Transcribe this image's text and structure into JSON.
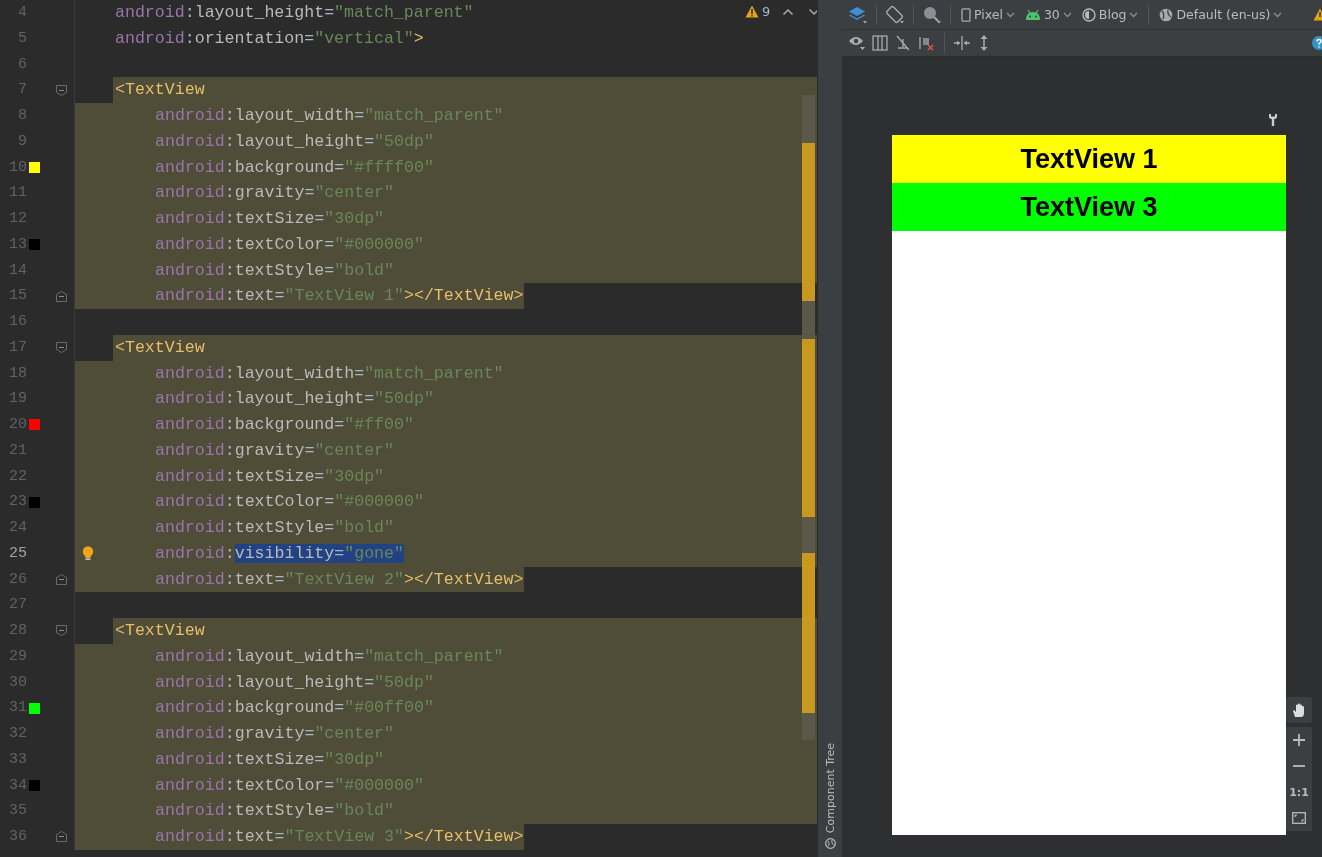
{
  "editor": {
    "warnings": "9",
    "lines": [
      {
        "num": "4",
        "current": false,
        "tokens": [
          {
            "ns": "android"
          },
          {
            "p": ":"
          },
          {
            "attr": "layout_height"
          },
          {
            "p": "="
          },
          {
            "str": "\"match_parent\""
          }
        ]
      },
      {
        "num": "5",
        "current": false,
        "tokens": [
          {
            "ns": "android"
          },
          {
            "p": ":"
          },
          {
            "attr": "orientation"
          },
          {
            "p": "="
          },
          {
            "str": "\"vertical\""
          },
          {
            "tag": ">"
          }
        ]
      },
      {
        "num": "6",
        "current": false
      },
      {
        "num": "7",
        "current": false,
        "tokens": [
          {
            "tag": "<TextView"
          }
        ],
        "children": [
          {
            "num": "8",
            "current": false,
            "tokens": [
              {
                "ns": "android"
              },
              {
                "p": ":"
              },
              {
                "attr": "layout_width"
              },
              {
                "p": "="
              },
              {
                "str": "\"match_parent\""
              }
            ]
          },
          {
            "num": "9",
            "current": false,
            "tokens": [
              {
                "ns": "android"
              },
              {
                "p": ":"
              },
              {
                "attr": "layout_height"
              },
              {
                "p": "="
              },
              {
                "str": "\"50dp\""
              }
            ]
          },
          {
            "num": "10",
            "current": false,
            "color": "#ffff00",
            "tokens": [
              {
                "ns": "android"
              },
              {
                "p": ":"
              },
              {
                "attr": "background"
              },
              {
                "p": "="
              },
              {
                "str": "\"#ffff00\""
              }
            ]
          },
          {
            "num": "11",
            "current": false,
            "tokens": [
              {
                "ns": "android"
              },
              {
                "p": ":"
              },
              {
                "attr": "gravity"
              },
              {
                "p": "="
              },
              {
                "str": "\"center\""
              }
            ]
          },
          {
            "num": "12",
            "current": false,
            "tokens": [
              {
                "ns": "android"
              },
              {
                "p": ":"
              },
              {
                "attr": "textSize"
              },
              {
                "p": "="
              },
              {
                "str": "\"30dp\""
              }
            ]
          },
          {
            "num": "13",
            "current": false,
            "color": "#000000",
            "tokens": [
              {
                "ns": "android"
              },
              {
                "p": ":"
              },
              {
                "attr": "textColor"
              },
              {
                "p": "="
              },
              {
                "str": "\"#000000\""
              }
            ]
          },
          {
            "num": "14",
            "current": false,
            "tokens": [
              {
                "ns": "android"
              },
              {
                "p": ":"
              },
              {
                "attr": "textStyle"
              },
              {
                "p": "="
              },
              {
                "str": "\"bold\""
              }
            ]
          },
          {
            "num": "15",
            "current": false,
            "tokens": [
              {
                "ns": "android"
              },
              {
                "p": ":"
              },
              {
                "attr": "text"
              },
              {
                "p": "="
              },
              {
                "str": "\"TextView 1\""
              },
              {
                "tag": "></TextView>"
              }
            ]
          }
        ]
      },
      {
        "num": "16",
        "current": false
      },
      {
        "num": "17",
        "current": false,
        "tokens": [
          {
            "tag": "<TextView"
          }
        ],
        "children": [
          {
            "num": "18",
            "current": false,
            "tokens": [
              {
                "ns": "android"
              },
              {
                "p": ":"
              },
              {
                "attr": "layout_width"
              },
              {
                "p": "="
              },
              {
                "str": "\"match_parent\""
              }
            ]
          },
          {
            "num": "19",
            "current": false,
            "tokens": [
              {
                "ns": "android"
              },
              {
                "p": ":"
              },
              {
                "attr": "layout_height"
              },
              {
                "p": "="
              },
              {
                "str": "\"50dp\""
              }
            ]
          },
          {
            "num": "20",
            "current": false,
            "color": "#ff0000",
            "tokens": [
              {
                "ns": "android"
              },
              {
                "p": ":"
              },
              {
                "attr": "background"
              },
              {
                "p": "="
              },
              {
                "str": "\"#ff00\""
              }
            ]
          },
          {
            "num": "21",
            "current": false,
            "tokens": [
              {
                "ns": "android"
              },
              {
                "p": ":"
              },
              {
                "attr": "gravity"
              },
              {
                "p": "="
              },
              {
                "str": "\"center\""
              }
            ]
          },
          {
            "num": "22",
            "current": false,
            "tokens": [
              {
                "ns": "android"
              },
              {
                "p": ":"
              },
              {
                "attr": "textSize"
              },
              {
                "p": "="
              },
              {
                "str": "\"30dp\""
              }
            ]
          },
          {
            "num": "23",
            "current": false,
            "color": "#000000",
            "tokens": [
              {
                "ns": "android"
              },
              {
                "p": ":"
              },
              {
                "attr": "textColor"
              },
              {
                "p": "="
              },
              {
                "str": "\"#000000\""
              }
            ]
          },
          {
            "num": "24",
            "current": false,
            "tokens": [
              {
                "ns": "android"
              },
              {
                "p": ":"
              },
              {
                "attr": "textStyle"
              },
              {
                "p": "="
              },
              {
                "str": "\"bold\""
              }
            ]
          },
          {
            "num": "25",
            "current": true,
            "hint": true,
            "tokens": [
              {
                "ns": "android"
              },
              {
                "p": ":"
              },
              {
                "selection": [
                  {
                    "attr": "visibility"
                  },
                  {
                    "p": "="
                  },
                  {
                    "str": "\"gone\""
                  }
                ]
              }
            ]
          },
          {
            "num": "26",
            "current": false,
            "tokens": [
              {
                "ns": "android"
              },
              {
                "p": ":"
              },
              {
                "attr": "text"
              },
              {
                "p": "="
              },
              {
                "str": "\"TextView 2\""
              },
              {
                "tag": "></TextView>"
              }
            ]
          }
        ]
      },
      {
        "num": "27",
        "current": false
      },
      {
        "num": "28",
        "current": false,
        "tokens": [
          {
            "tag": "<TextView"
          }
        ],
        "children": [
          {
            "num": "29",
            "current": false,
            "tokens": [
              {
                "ns": "android"
              },
              {
                "p": ":"
              },
              {
                "attr": "layout_width"
              },
              {
                "p": "="
              },
              {
                "str": "\"match_parent\""
              }
            ]
          },
          {
            "num": "30",
            "current": false,
            "tokens": [
              {
                "ns": "android"
              },
              {
                "p": ":"
              },
              {
                "attr": "layout_height"
              },
              {
                "p": "="
              },
              {
                "str": "\"50dp\""
              }
            ]
          },
          {
            "num": "31",
            "current": false,
            "color": "#00ff00",
            "tokens": [
              {
                "ns": "android"
              },
              {
                "p": ":"
              },
              {
                "attr": "background"
              },
              {
                "p": "="
              },
              {
                "str": "\"#00ff00\""
              }
            ]
          },
          {
            "num": "32",
            "current": false,
            "tokens": [
              {
                "ns": "android"
              },
              {
                "p": ":"
              },
              {
                "attr": "gravity"
              },
              {
                "p": "="
              },
              {
                "str": "\"center\""
              }
            ]
          },
          {
            "num": "33",
            "current": false,
            "tokens": [
              {
                "ns": "android"
              },
              {
                "p": ":"
              },
              {
                "attr": "textSize"
              },
              {
                "p": "="
              },
              {
                "str": "\"30dp\""
              }
            ]
          },
          {
            "num": "34",
            "current": false,
            "color": "#000000",
            "tokens": [
              {
                "ns": "android"
              },
              {
                "p": ":"
              },
              {
                "attr": "textColor"
              },
              {
                "p": "="
              },
              {
                "str": "\"#000000\""
              }
            ]
          },
          {
            "num": "35",
            "current": false,
            "tokens": [
              {
                "ns": "android"
              },
              {
                "p": ":"
              },
              {
                "attr": "textStyle"
              },
              {
                "p": "="
              },
              {
                "str": "\"bold\""
              }
            ]
          },
          {
            "num": "36",
            "current": false,
            "tokens": [
              {
                "ns": "android"
              },
              {
                "p": ":"
              },
              {
                "attr": "text"
              },
              {
                "p": "="
              },
              {
                "str": "\"TextView 3\""
              },
              {
                "tag": "></TextView>"
              }
            ]
          }
        ]
      }
    ]
  },
  "side_tab": {
    "label": "Component Tree"
  },
  "toolbar": {
    "device": "Pixel",
    "api": "30",
    "theme": "Blog",
    "locale": "Default (en-us)"
  },
  "preview": {
    "views": [
      {
        "text": "TextView 1",
        "color": "#ffff00"
      },
      {
        "text": "TextView 3",
        "color": "#00ff00"
      }
    ]
  },
  "zoom_controls": {
    "actual_size": "1:1"
  }
}
